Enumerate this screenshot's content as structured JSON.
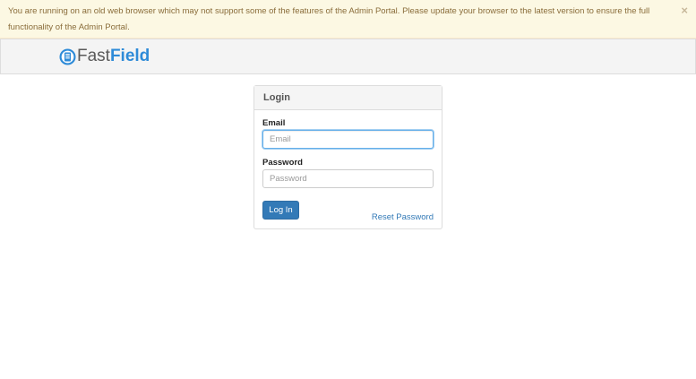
{
  "alert": {
    "message": "You are running on an old web browser which may not support some of the features of the Admin Portal. Please update your browser to the latest version to ensure the full functionality of the Admin Portal.",
    "close_symbol": "×"
  },
  "brand": {
    "part1": "Fast",
    "part2": "Field",
    "icon": "fastfield-logo-icon"
  },
  "login": {
    "heading": "Login",
    "email_label": "Email",
    "email_placeholder": "Email",
    "email_value": "",
    "password_label": "Password",
    "password_placeholder": "Password",
    "password_value": "",
    "submit_label": "Log In",
    "reset_label": "Reset Password"
  },
  "colors": {
    "alert_bg": "#fcf8e3",
    "alert_text": "#8a6d3b",
    "brand_accent": "#2e8bd8",
    "primary": "#337ab7"
  }
}
